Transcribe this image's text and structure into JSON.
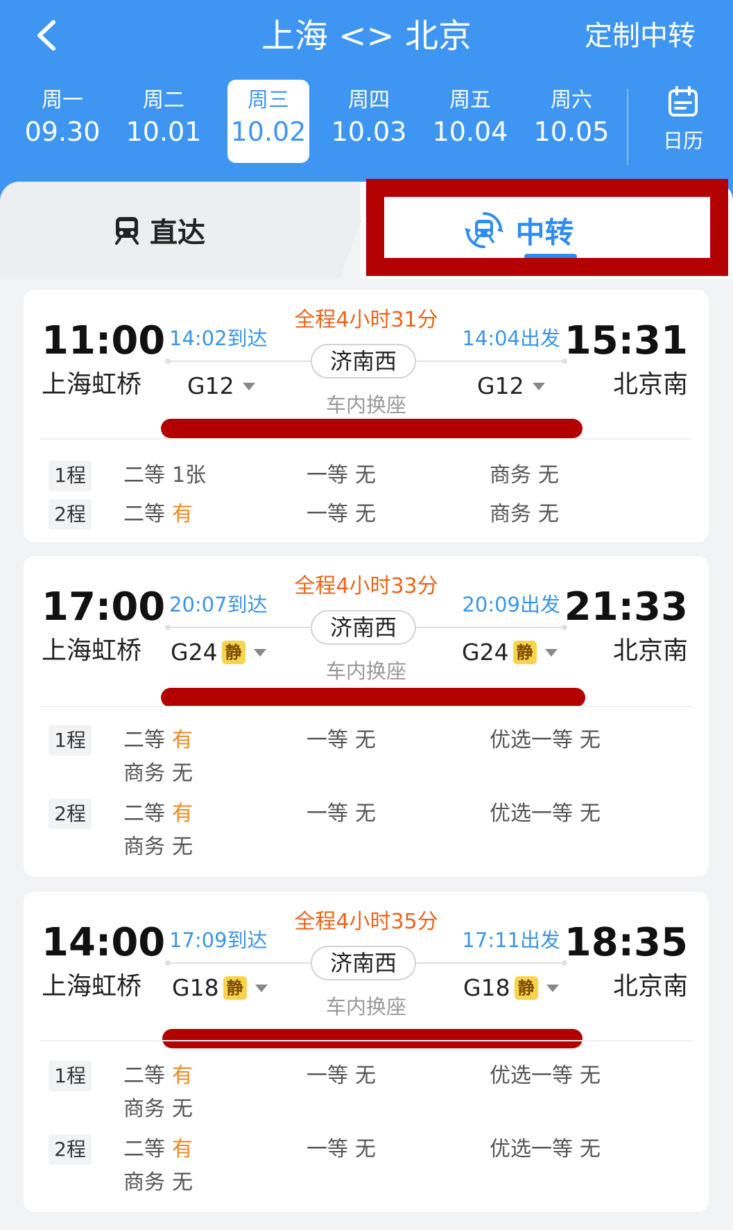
{
  "header": {
    "title": "上海 <> 北京",
    "custom_label": "定制中转",
    "calendar_label": "日历",
    "dates": [
      {
        "weekday": "周一",
        "date": "09.30"
      },
      {
        "weekday": "周二",
        "date": "10.01"
      },
      {
        "weekday": "周三",
        "date": "10.02"
      },
      {
        "weekday": "周四",
        "date": "10.03"
      },
      {
        "weekday": "周五",
        "date": "10.04"
      },
      {
        "weekday": "周六",
        "date": "10.05"
      }
    ],
    "selected_date_index": 2
  },
  "tabs": {
    "direct": "直达",
    "transfer": "中转",
    "active": "transfer"
  },
  "colors": {
    "header_bg": "#3f96f2",
    "accent_blue": "#2f8df0",
    "orange": "#e8651c",
    "highlight_red": "#b30000"
  },
  "results": [
    {
      "dep_time": "11:00",
      "dep_station": "上海虹桥",
      "arr_time": "15:31",
      "arr_station": "北京南",
      "total": "全程4小时31分",
      "leg1_arrive": "14:02到达",
      "leg2_depart": "14:04出发",
      "via": "济南西",
      "swap": "车内换座",
      "train1": "G12",
      "train2": "G12",
      "quiet1": "",
      "quiet2": "",
      "legs": [
        {
          "label": "1程",
          "seats": [
            {
              "name": "二等",
              "value": "1张"
            },
            {
              "name": "一等",
              "value": "无"
            },
            {
              "name": "商务",
              "value": "无"
            }
          ]
        },
        {
          "label": "2程",
          "seats": [
            {
              "name": "二等",
              "value": "有"
            },
            {
              "name": "一等",
              "value": "无"
            },
            {
              "name": "商务",
              "value": "无"
            }
          ]
        }
      ]
    },
    {
      "dep_time": "17:00",
      "dep_station": "上海虹桥",
      "arr_time": "21:33",
      "arr_station": "北京南",
      "total": "全程4小时33分",
      "leg1_arrive": "20:07到达",
      "leg2_depart": "20:09出发",
      "via": "济南西",
      "swap": "车内换座",
      "train1": "G24",
      "train2": "G24",
      "quiet1": "静",
      "quiet2": "静",
      "legs": [
        {
          "label": "1程",
          "seats": [
            {
              "name": "二等",
              "value": "有"
            },
            {
              "name": "一等",
              "value": "无"
            },
            {
              "name": "优选一等",
              "value": "无"
            },
            {
              "name": "商务",
              "value": "无"
            }
          ]
        },
        {
          "label": "2程",
          "seats": [
            {
              "name": "二等",
              "value": "有"
            },
            {
              "name": "一等",
              "value": "无"
            },
            {
              "name": "优选一等",
              "value": "无"
            },
            {
              "name": "商务",
              "value": "无"
            }
          ]
        }
      ]
    },
    {
      "dep_time": "14:00",
      "dep_station": "上海虹桥",
      "arr_time": "18:35",
      "arr_station": "北京南",
      "total": "全程4小时35分",
      "leg1_arrive": "17:09到达",
      "leg2_depart": "17:11出发",
      "via": "济南西",
      "swap": "车内换座",
      "train1": "G18",
      "train2": "G18",
      "quiet1": "静",
      "quiet2": "静",
      "legs": [
        {
          "label": "1程",
          "seats": [
            {
              "name": "二等",
              "value": "有"
            },
            {
              "name": "一等",
              "value": "无"
            },
            {
              "name": "优选一等",
              "value": "无"
            },
            {
              "name": "商务",
              "value": "无"
            }
          ]
        },
        {
          "label": "2程",
          "seats": [
            {
              "name": "二等",
              "value": "有"
            },
            {
              "name": "一等",
              "value": "无"
            },
            {
              "name": "优选一等",
              "value": "无"
            },
            {
              "name": "商务",
              "value": "无"
            }
          ]
        }
      ]
    }
  ]
}
